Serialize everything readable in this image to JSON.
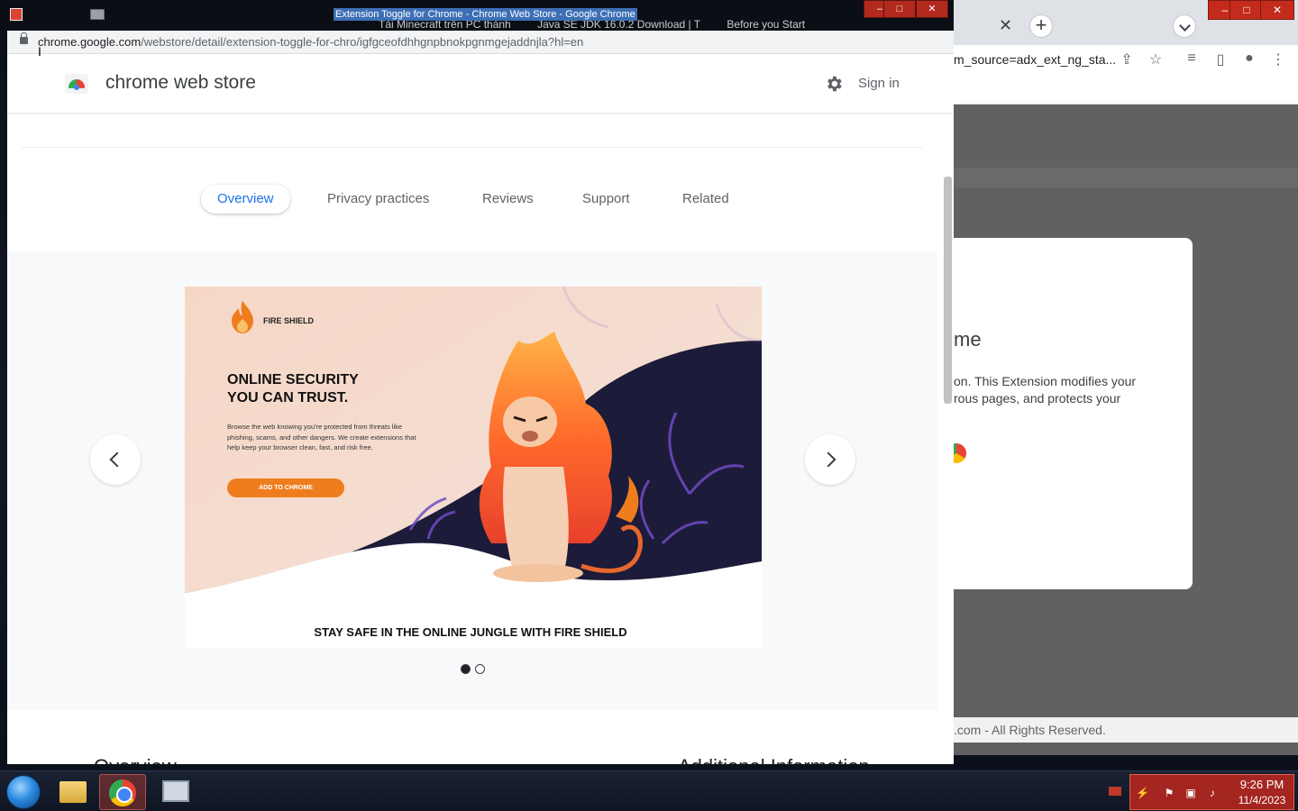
{
  "popup_window": {
    "title": "Extension Toggle for Chrome - Chrome Web Store - Google Chrome",
    "background_tabs": [
      "Tải Minecraft trên PC thành",
      "Java SE JDK 16.0.2 Download | T",
      "Before you Start"
    ],
    "url_host": "chrome.google.com",
    "url_path": "/webstore/detail/extension-toggle-for-chro/igfgceofdhhgnpbnokpgnmgejaddnjla?hl=en"
  },
  "store": {
    "title": "chrome web store",
    "sign_in": "Sign in",
    "tabs": [
      {
        "label": "Overview",
        "active": true
      },
      {
        "label": "Privacy practices",
        "active": false
      },
      {
        "label": "Reviews",
        "active": false
      },
      {
        "label": "Support",
        "active": false
      },
      {
        "label": "Related",
        "active": false
      }
    ],
    "lower_left_heading": "Overview",
    "lower_right_heading": "Additional Information"
  },
  "slide": {
    "brand": "FIRE SHIELD",
    "headline": "ONLINE SECURITY\nYOU CAN TRUST.",
    "body": "Browse the web knowing you're protected from threats like phishing, scams, and other dangers. We create extensions that help keep your browser clean, fast, and risk free.",
    "cta": "ADD TO CHROME",
    "caption": "STAY SAFE IN THE ONLINE JUNGLE WITH FIRE SHIELD",
    "current_index": 1,
    "total": 2
  },
  "background_window": {
    "url_fragment": "m_source=adx_ext_ng_sta...",
    "dialog_title_fragment": "me",
    "dialog_text_fragment": "on. This Extension modifies your\nrous pages, and protects your",
    "footer_fragment": ".com - All Rights Reserved."
  },
  "taskbar": {
    "time": "9:26 PM",
    "date": "11/4/2023"
  },
  "colors": {
    "accent_blue": "#1a73e8",
    "fire_orange": "#ef7d1e",
    "slide_dark": "#1d1b3a",
    "taskbar_tray": "#be281e"
  }
}
